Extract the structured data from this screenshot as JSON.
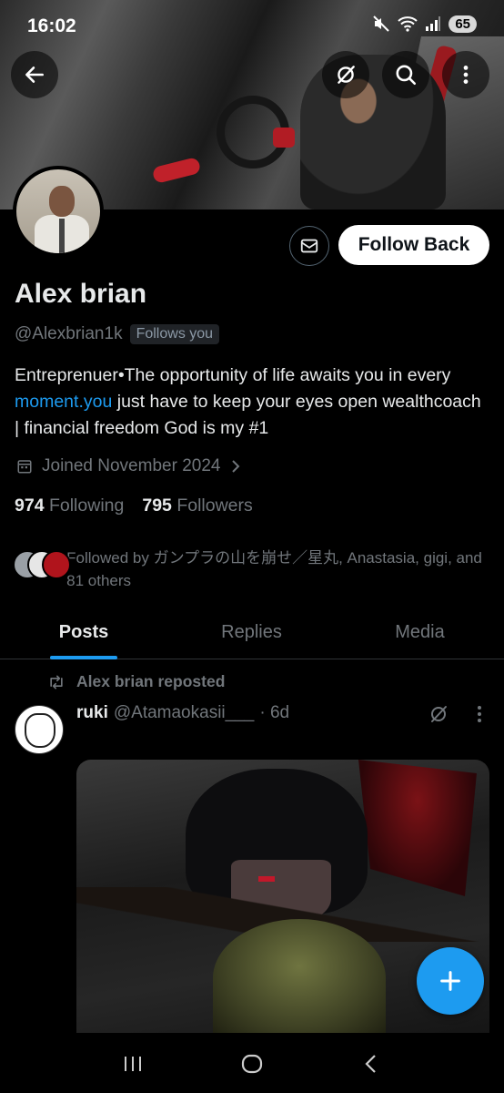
{
  "status_bar": {
    "time": "16:02",
    "battery": "65"
  },
  "profile": {
    "display_name": "Alex brian",
    "handle": "@Alexbrian1k",
    "follows_you_label": "Follows you",
    "follow_button_label": "Follow Back",
    "bio_part1": "Entreprenuer•The opportunity of life awaits you in every ",
    "bio_link": "moment.you",
    "bio_part2": " just have to keep your eyes open wealthcoach | financial freedom God is my #1",
    "joined": "Joined November 2024",
    "following_count": "974",
    "following_label": "Following",
    "followers_count": "795",
    "followers_label": "Followers",
    "followed_by_text": "Followed by ガンプラの山を崩せ／星丸, Anastasia, gigi, and 81 others"
  },
  "tabs": [
    {
      "label": "Posts",
      "active": true
    },
    {
      "label": "Replies",
      "active": false
    },
    {
      "label": "Media",
      "active": false
    }
  ],
  "post": {
    "repost_label": "Alex brian reposted",
    "author_name": "ruki",
    "author_handle": "@Atamaokasii___",
    "time": "· 6d"
  },
  "icons": {
    "back": "arrow-left-icon",
    "grok": "grok-icon",
    "search": "search-icon",
    "more": "more-vertical-icon",
    "message": "envelope-icon",
    "calendar": "calendar-icon",
    "repost": "repost-icon",
    "compose": "plus-icon"
  },
  "colors": {
    "accent": "#1d9bf0",
    "background": "#000000",
    "muted_text": "#71767b"
  }
}
